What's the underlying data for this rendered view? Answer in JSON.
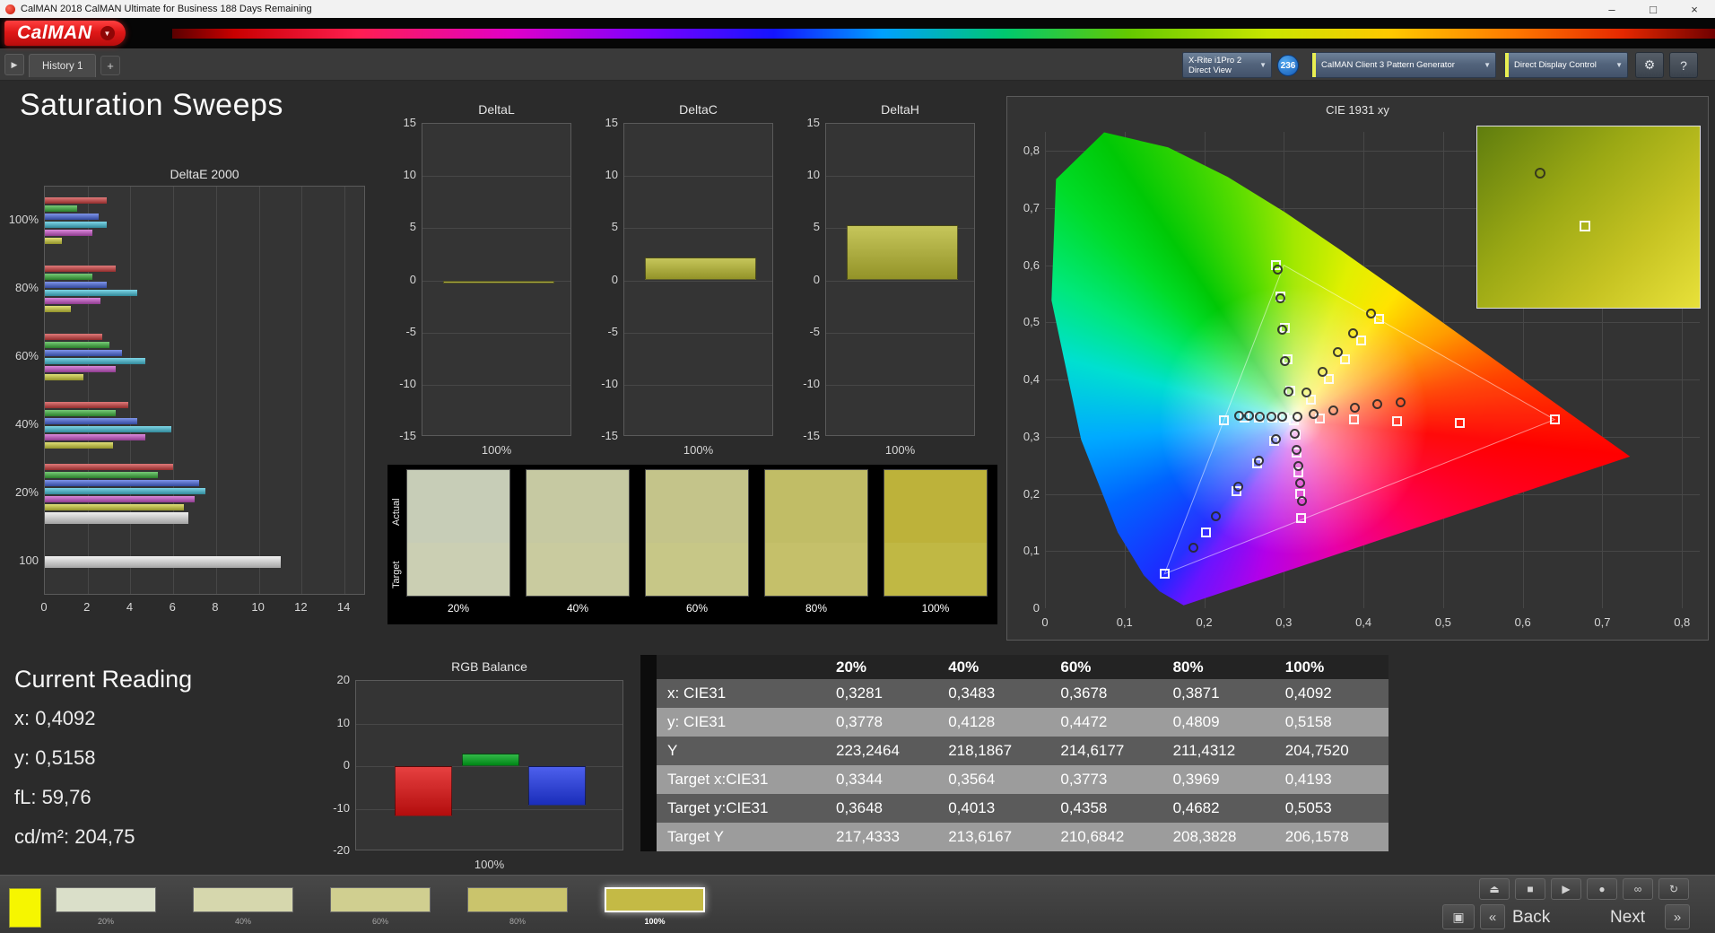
{
  "window": {
    "title": "CalMAN 2018 CalMAN Ultimate for Business 188 Days Remaining",
    "controls": {
      "minimize": "–",
      "maximize": "□",
      "close": "×"
    }
  },
  "header": {
    "logo": "CalMAN",
    "logo_caret": "▼",
    "expander": "▶",
    "tab": "History 1",
    "add_tab": "+",
    "meter_line1": "X-Rite i1Pro 2",
    "meter_line2": "Direct View",
    "badge": "236",
    "pattern_generator": "CalMAN Client 3 Pattern Generator",
    "display_control": "Direct Display Control",
    "gear": "⚙",
    "help": "?",
    "dropdown_caret": "▼"
  },
  "page_title": "Saturation Sweeps",
  "current_reading": {
    "title": "Current Reading",
    "lines": [
      "x: 0,4092",
      "y: 0,5158",
      "fL: 59,76",
      "cd/m²: 204,75"
    ]
  },
  "swatch_panel": {
    "actual_label": "Actual",
    "target_label": "Target",
    "swatches": [
      {
        "label": "20%",
        "actual": "#c7cdb7",
        "target": "#cbcfb3"
      },
      {
        "label": "40%",
        "actual": "#c6c9a2",
        "target": "#c9cb9f"
      },
      {
        "label": "60%",
        "actual": "#c4c48a",
        "target": "#c7c787"
      },
      {
        "label": "80%",
        "actual": "#c1bd66",
        "target": "#c5c06a"
      },
      {
        "label": "100%",
        "actual": "#bdb23a",
        "target": "#c0b844"
      }
    ]
  },
  "table": {
    "header": [
      "",
      "20%",
      "40%",
      "60%",
      "80%",
      "100%"
    ],
    "rows": [
      [
        "x: CIE31",
        "0,3281",
        "0,3483",
        "0,3678",
        "0,3871",
        "0,4092"
      ],
      [
        "y: CIE31",
        "0,3778",
        "0,4128",
        "0,4472",
        "0,4809",
        "0,5158"
      ],
      [
        "Y",
        "223,2464",
        "218,1867",
        "214,6177",
        "211,4312",
        "204,7520"
      ],
      [
        "Target x:CIE31",
        "0,3344",
        "0,3564",
        "0,3773",
        "0,3969",
        "0,4193"
      ],
      [
        "Target y:CIE31",
        "0,3648",
        "0,4013",
        "0,4358",
        "0,4682",
        "0,5053"
      ],
      [
        "Target Y",
        "217,4333",
        "213,6167",
        "210,6842",
        "208,3828",
        "206,1578"
      ]
    ]
  },
  "bottom_bar": {
    "current_patch_color": "#f6f600",
    "thumbnails": [
      {
        "label": "20%",
        "color": "#dadfc9",
        "selected": false
      },
      {
        "label": "40%",
        "color": "#d6d7ad",
        "selected": false
      },
      {
        "label": "60%",
        "color": "#d0cf90",
        "selected": false
      },
      {
        "label": "80%",
        "color": "#cac46c",
        "selected": false
      },
      {
        "label": "100%",
        "color": "#c4ba45",
        "selected": true
      }
    ],
    "transport_row1": [
      "⏏",
      "■",
      "▶",
      "●",
      "∞",
      "↻"
    ],
    "transport_row1_names": [
      "eject",
      "stop",
      "play",
      "record",
      "loop",
      "repeat"
    ],
    "pattern_button_icon": "▣",
    "back_chevron": "«",
    "back_label": "Back",
    "next_label": "Next",
    "next_chevron": "»"
  },
  "chart_data": [
    {
      "type": "bar",
      "title": "DeltaE 2000",
      "orientation": "horizontal",
      "xmax": 15,
      "xtick_values": [
        0,
        2,
        4,
        6,
        8,
        10,
        12,
        14
      ],
      "xtick_labels": [
        "0",
        "2",
        "4",
        "6",
        "8",
        "10",
        "12",
        "14"
      ],
      "groups": [
        {
          "label": "100%",
          "bars": [
            {
              "c": "#d24040",
              "v": 2.9
            },
            {
              "c": "#3cb43c",
              "v": 1.5
            },
            {
              "c": "#4868e0",
              "v": 2.5
            },
            {
              "c": "#46c3dc",
              "v": 2.9
            },
            {
              "c": "#cc55cc",
              "v": 2.2
            },
            {
              "c": "#d2d23c",
              "v": 0.8
            }
          ]
        },
        {
          "label": "80%",
          "bars": [
            {
              "c": "#d24040",
              "v": 3.3
            },
            {
              "c": "#3cb43c",
              "v": 2.2
            },
            {
              "c": "#4868e0",
              "v": 2.9
            },
            {
              "c": "#46c3dc",
              "v": 4.3
            },
            {
              "c": "#cc55cc",
              "v": 2.6
            },
            {
              "c": "#d2d23c",
              "v": 1.2
            }
          ]
        },
        {
          "label": "60%",
          "bars": [
            {
              "c": "#d24040",
              "v": 2.7
            },
            {
              "c": "#3cb43c",
              "v": 3.0
            },
            {
              "c": "#4868e0",
              "v": 3.6
            },
            {
              "c": "#46c3dc",
              "v": 4.7
            },
            {
              "c": "#cc55cc",
              "v": 3.3
            },
            {
              "c": "#d2d23c",
              "v": 1.8
            }
          ]
        },
        {
          "label": "40%",
          "bars": [
            {
              "c": "#d24040",
              "v": 3.9
            },
            {
              "c": "#3cb43c",
              "v": 3.3
            },
            {
              "c": "#4868e0",
              "v": 4.3
            },
            {
              "c": "#46c3dc",
              "v": 5.9
            },
            {
              "c": "#cc55cc",
              "v": 4.7
            },
            {
              "c": "#d2d23c",
              "v": 3.2
            }
          ]
        },
        {
          "label": "20%",
          "bars": [
            {
              "c": "#d24040",
              "v": 6.0
            },
            {
              "c": "#3cb43c",
              "v": 5.3
            },
            {
              "c": "#4868e0",
              "v": 7.2
            },
            {
              "c": "#46c3dc",
              "v": 7.5
            },
            {
              "c": "#cc55cc",
              "v": 7.0
            },
            {
              "c": "#d2d23c",
              "v": 6.5
            },
            {
              "c": "#e8e8e8",
              "v": 6.7,
              "thick": true
            }
          ]
        },
        {
          "label": "100",
          "bars": [
            {
              "c": "#ececec",
              "v": 11.0,
              "thick": true
            }
          ]
        }
      ]
    },
    {
      "type": "bar",
      "title": "DeltaL",
      "value": -0.15,
      "color": "#b8b832",
      "ymin": -15,
      "ymax": 15,
      "ytick_values": [
        15,
        10,
        5,
        0,
        -5,
        -10,
        -15
      ],
      "ytick_labels": [
        "15",
        "10",
        "5",
        "0",
        "-5",
        "-10",
        "-15"
      ],
      "xlabel": "100%"
    },
    {
      "type": "bar",
      "title": "DeltaC",
      "value": 2.2,
      "color": "#b8b832",
      "ymin": -15,
      "ymax": 15,
      "ytick_values": [
        15,
        10,
        5,
        0,
        -5,
        -10,
        -15
      ],
      "ytick_labels": [
        "15",
        "10",
        "5",
        "0",
        "-5",
        "-10",
        "-15"
      ],
      "xlabel": "100%"
    },
    {
      "type": "bar",
      "title": "DeltaH",
      "value": 5.3,
      "color": "#b8b832",
      "ymin": -15,
      "ymax": 15,
      "ytick_values": [
        15,
        10,
        5,
        0,
        -5,
        -10,
        -15
      ],
      "ytick_labels": [
        "15",
        "10",
        "5",
        "0",
        "-5",
        "-10",
        "-15"
      ],
      "xlabel": "100%"
    },
    {
      "type": "bar",
      "title": "RGB Balance",
      "categories": [
        "Red",
        "Green",
        "Blue"
      ],
      "values": [
        -11.7,
        3.0,
        -9.3
      ],
      "colors": [
        "#e01010",
        "#00a81c",
        "#2038e8"
      ],
      "ymin": -20,
      "ymax": 20,
      "ytick_values": [
        20,
        10,
        0,
        -10,
        -20
      ],
      "ytick_labels": [
        "20",
        "10",
        "0",
        "-10",
        "-20"
      ],
      "xlabel": "100%"
    },
    {
      "type": "scatter",
      "title": "CIE 1931 xy",
      "xlim": [
        0,
        0.8225
      ],
      "ylim": [
        0,
        0.833
      ],
      "tick_labels": [
        "0",
        "0,1",
        "0,2",
        "0,3",
        "0,4",
        "0,5",
        "0,6",
        "0,7",
        "0,8"
      ],
      "gamut_triangle": [
        [
          0.64,
          0.33
        ],
        [
          0.3,
          0.6
        ],
        [
          0.15,
          0.06
        ]
      ],
      "measured_points": [
        [
          0.3281,
          0.3778
        ],
        [
          0.3483,
          0.4128
        ],
        [
          0.3678,
          0.4472
        ],
        [
          0.3871,
          0.4809
        ],
        [
          0.4092,
          0.5158
        ],
        [
          0.3062,
          0.3781
        ],
        [
          0.3015,
          0.4322
        ],
        [
          0.2978,
          0.4869
        ],
        [
          0.2952,
          0.5415
        ],
        [
          0.2927,
          0.5921
        ],
        [
          0.3372,
          0.3402
        ],
        [
          0.3625,
          0.3455
        ],
        [
          0.3893,
          0.3508
        ],
        [
          0.4175,
          0.3562
        ],
        [
          0.4466,
          0.3601
        ],
        [
          0.2981,
          0.3342
        ],
        [
          0.2843,
          0.3348
        ],
        [
          0.2702,
          0.3355
        ],
        [
          0.2568,
          0.3362
        ],
        [
          0.2437,
          0.3371
        ],
        [
          0.2902,
          0.2962
        ],
        [
          0.2681,
          0.2581
        ],
        [
          0.2432,
          0.2121
        ],
        [
          0.2151,
          0.1601
        ],
        [
          0.1862,
          0.1052
        ],
        [
          0.3142,
          0.3051
        ],
        [
          0.3161,
          0.2772
        ],
        [
          0.3182,
          0.2481
        ],
        [
          0.3204,
          0.2182
        ],
        [
          0.3223,
          0.1881
        ],
        [
          0.3169,
          0.3344
        ]
      ],
      "target_points": [
        [
          0.3344,
          0.3648
        ],
        [
          0.3564,
          0.4013
        ],
        [
          0.3773,
          0.4358
        ],
        [
          0.3969,
          0.4682
        ],
        [
          0.4193,
          0.5053
        ],
        [
          0.3082,
          0.3802
        ],
        [
          0.3051,
          0.4352
        ],
        [
          0.3012,
          0.4902
        ],
        [
          0.2962,
          0.5452
        ],
        [
          0.2901,
          0.6002
        ],
        [
          0.3457,
          0.3314
        ],
        [
          0.3877,
          0.3298
        ],
        [
          0.4421,
          0.3276
        ],
        [
          0.5208,
          0.3247
        ],
        [
          0.64,
          0.33
        ],
        [
          0.2998,
          0.3329
        ],
        [
          0.2852,
          0.3331
        ],
        [
          0.2689,
          0.3334
        ],
        [
          0.2506,
          0.3337
        ],
        [
          0.225,
          0.329
        ],
        [
          0.2873,
          0.2926
        ],
        [
          0.2661,
          0.2528
        ],
        [
          0.2405,
          0.2048
        ],
        [
          0.2017,
          0.132
        ],
        [
          0.15,
          0.06
        ],
        [
          0.3146,
          0.3028
        ],
        [
          0.3164,
          0.2721
        ],
        [
          0.3183,
          0.2383
        ],
        [
          0.3204,
          0.2006
        ],
        [
          0.3221,
          0.158
        ],
        [
          0.3127,
          0.329
        ]
      ]
    }
  ]
}
